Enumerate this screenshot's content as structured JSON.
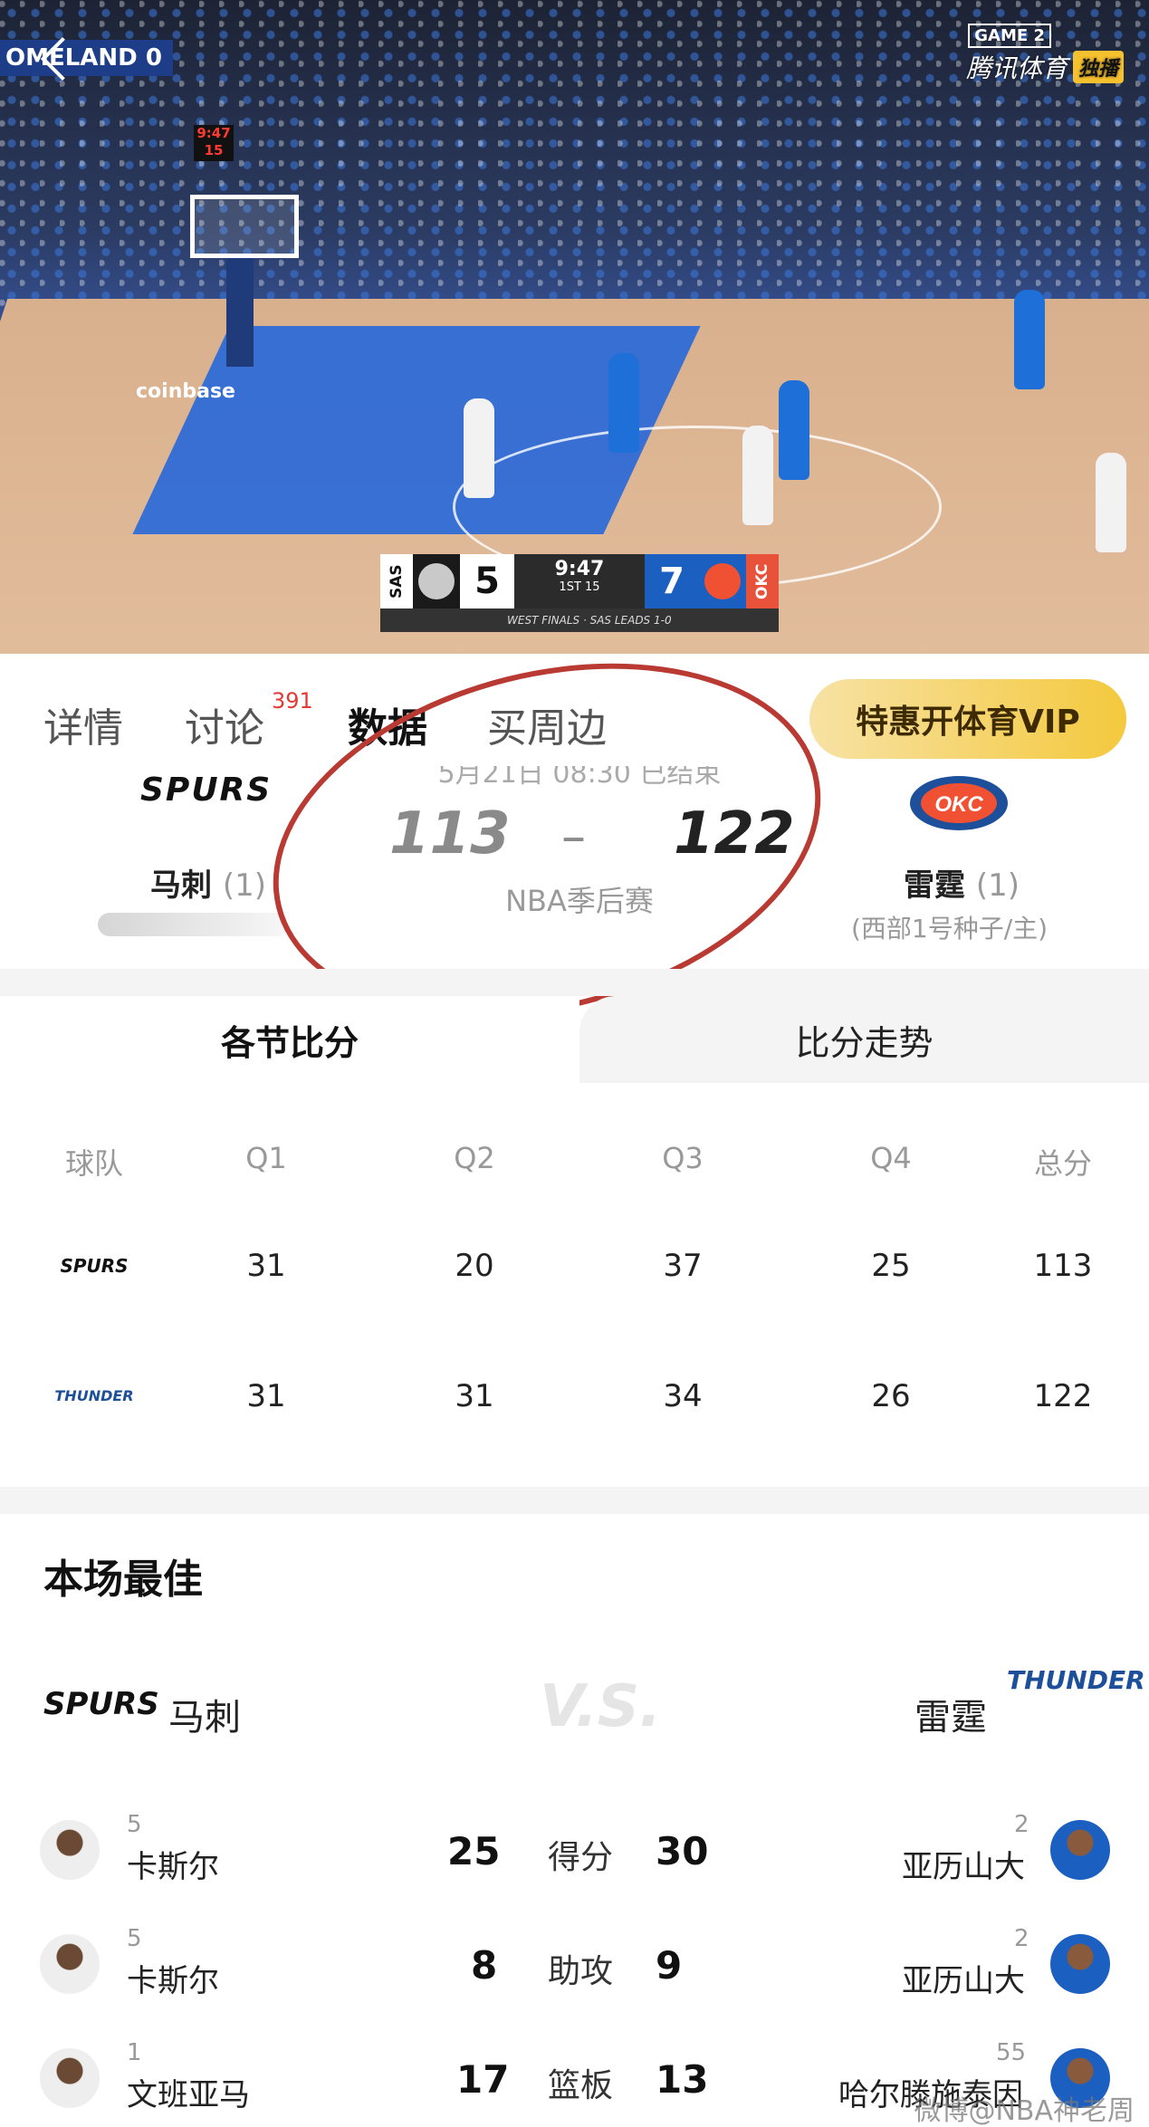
{
  "video": {
    "top_left_label": "OMELAND 0",
    "game_label": "GAME 2",
    "broadcaster": "腾讯体育",
    "broadcast_badge": "独播",
    "shot_clock": [
      "9:47",
      "15"
    ],
    "ad_text": "coinbase",
    "scorebug": {
      "away_abbr": "SAS",
      "away_score": "5",
      "clock": "9:47",
      "period": "1ST",
      "shot": "15",
      "home_score": "7",
      "home_abbr": "OKC",
      "strip": "WEST FINALS · SAS LEADS 1-0"
    }
  },
  "tabs": [
    {
      "label": "详情",
      "active": false
    },
    {
      "label": "讨论",
      "active": false,
      "badge": "391"
    },
    {
      "label": "数据",
      "active": true
    },
    {
      "label": "买周边",
      "active": false
    }
  ],
  "vip_button": "特惠开体育VIP",
  "match": {
    "date_partial": "5月21日 08:30 已结束",
    "away": {
      "name": "马刺",
      "rank": "(1)",
      "logo_text": "SPURS"
    },
    "home": {
      "name": "雷霆",
      "rank": "(1)",
      "seed": "(西部1号种子/主)",
      "logo_text": "OKC"
    },
    "away_score": "113",
    "dash": "–",
    "home_score": "122",
    "event": "NBA季后赛"
  },
  "score_tabs": {
    "active": "各节比分",
    "inactive": "比分走势"
  },
  "quarter_table": {
    "headers": [
      "球队",
      "Q1",
      "Q2",
      "Q3",
      "Q4",
      "总分"
    ],
    "rows": [
      {
        "team_logo": "SPURS",
        "values": [
          "31",
          "20",
          "37",
          "25",
          "113"
        ]
      },
      {
        "team_logo": "THUNDER",
        "values": [
          "31",
          "31",
          "34",
          "26",
          "122"
        ]
      }
    ]
  },
  "best": {
    "title": "本场最佳",
    "left_team": "马刺",
    "left_logo": "SPURS",
    "vs": "V.S.",
    "right_team": "雷霆",
    "right_logo": "THUNDER",
    "rows": [
      {
        "left_num": "5",
        "left_name": "卡斯尔",
        "left_val": "25",
        "stat": "得分",
        "right_val": "30",
        "right_num": "2",
        "right_name": "亚历山大"
      },
      {
        "left_num": "5",
        "left_name": "卡斯尔",
        "left_val": "8",
        "stat": "助攻",
        "right_val": "9",
        "right_num": "2",
        "right_name": "亚历山大"
      },
      {
        "left_num": "1",
        "left_name": "文班亚马",
        "left_val": "17",
        "stat": "篮板",
        "right_val": "13",
        "right_num": "55",
        "right_name": "哈尔滕施泰因"
      }
    ]
  },
  "watermark": "微博@NBA神老周",
  "colors": {
    "accent_red": "#b93a32",
    "vip_gold": "#f4c93e",
    "okc_blue": "#1b5fc1"
  }
}
